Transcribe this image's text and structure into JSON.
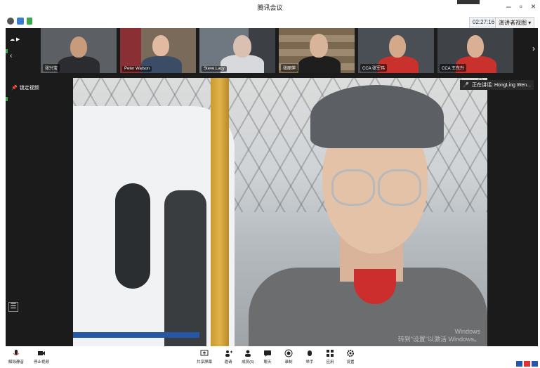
{
  "window": {
    "title": "腾讯会议"
  },
  "top_strip": {
    "timer": "02:27:16",
    "layout_label": "演讲者视图"
  },
  "gallery": {
    "tiles": [
      {
        "label": "张兴宝"
      },
      {
        "label": "Peter Watson"
      },
      {
        "label": "Steve.Lacy"
      },
      {
        "label": "张丽萍"
      },
      {
        "label": "CCA 张军伟"
      },
      {
        "label": "CCA 王东升"
      }
    ]
  },
  "stage": {
    "speaker_label": "正在讲话: HongLing Wen...",
    "pin_label": "锁定视频",
    "watermark_line1": "Windows",
    "watermark_line2": "转到\"设置\"以激活 Windows。"
  },
  "toolbar": {
    "mute": "解除静音",
    "stop_video": "停止视频",
    "share": "共享屏幕",
    "invite": "邀请",
    "members": "成员(6)",
    "chat": "聊天",
    "record": "录制",
    "raise_hand": "举手",
    "apps": "应用",
    "settings": "设置"
  },
  "colors": {
    "stage_bg": "#1b1b1b",
    "accent": "#2656a8",
    "active": "#3aa84c"
  }
}
